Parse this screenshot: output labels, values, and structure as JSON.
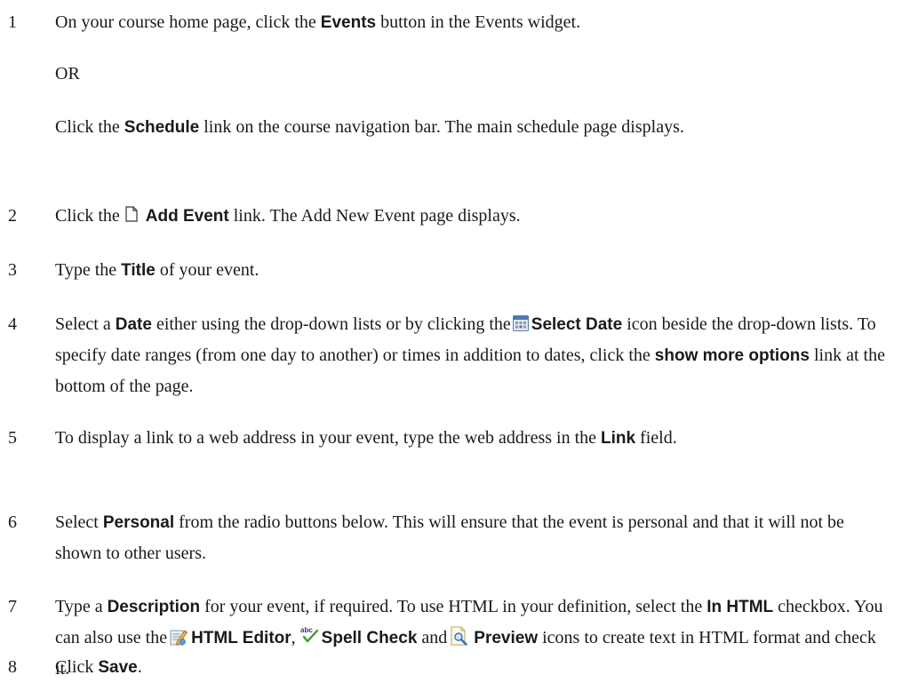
{
  "steps": [
    {
      "num": "1",
      "a": "On your course home page, click the ",
      "b1": "Events",
      "c": " button in the Events widget.",
      "or": "OR",
      "alt_a": "Click the ",
      "alt_b": "Schedule",
      "alt_c": " link on the course navigation bar. The main schedule page displays."
    },
    {
      "num": "2",
      "a": "Click the",
      "icon": "document-icon",
      "b1": "Add Event",
      "c": " link. The Add New Event page displays."
    },
    {
      "num": "3",
      "a": "Type the ",
      "b1": "Title",
      "c": " of your event."
    },
    {
      "num": "4",
      "a": "Select a ",
      "b1": "Date",
      "c": " either using the drop-down lists or by clicking the",
      "icon": "calendar-icon",
      "b2": "Select Date",
      "d": " icon beside the drop-down lists. To specify date ranges (from one day to another) or times in addition to dates, click the ",
      "b3": "show more options",
      "e": " link at the bottom of the page."
    },
    {
      "num": "5",
      "a": "To display a link to a web address in your event, type the web address in the ",
      "b1": "Link",
      "c": " field."
    },
    {
      "num": "6",
      "a": "Select ",
      "b1": "Personal",
      "c": " from the radio buttons below. This will ensure that the event is personal and that it will not be shown to other users."
    },
    {
      "num": "7",
      "a": "Type a ",
      "b1": "Description",
      "c": " for your event, if required. To use HTML in your definition, select the ",
      "b2": "In HTML",
      "d": " checkbox. You can also use the",
      "icon1": "html-editor-icon",
      "b3": "HTML Editor",
      "e": ",",
      "icon2": "spell-check-icon",
      "b4": "Spell Check",
      "f": " and",
      "icon3": "preview-icon",
      "b5": "Preview",
      "g": " icons to create text in HTML format and check it."
    },
    {
      "num": "8",
      "a": "Click ",
      "b1": "Save",
      "c": "."
    }
  ]
}
